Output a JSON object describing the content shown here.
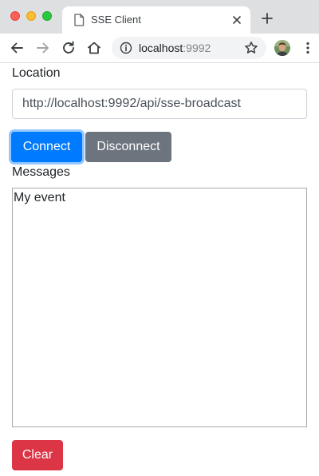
{
  "browser": {
    "tab": {
      "title": "SSE Client"
    },
    "address_bar": {
      "host": "localhost",
      "port": ":9992"
    }
  },
  "page": {
    "location": {
      "label": "Location",
      "value": "http://localhost:9992/api/sse-broadcast"
    },
    "buttons": {
      "connect": "Connect",
      "disconnect": "Disconnect",
      "clear": "Clear"
    },
    "messages": {
      "label": "Messages",
      "content": "My event"
    }
  },
  "colors": {
    "primary": "#007bff",
    "secondary": "#6c757d",
    "danger": "#dc3545"
  },
  "icons": [
    "close-window-icon",
    "minimize-window-icon",
    "maximize-window-icon",
    "page-icon",
    "close-tab-icon",
    "new-tab-icon",
    "back-arrow-icon",
    "forward-arrow-icon",
    "reload-icon",
    "home-icon",
    "info-icon",
    "star-icon",
    "profile-avatar",
    "kebab-menu-icon"
  ]
}
